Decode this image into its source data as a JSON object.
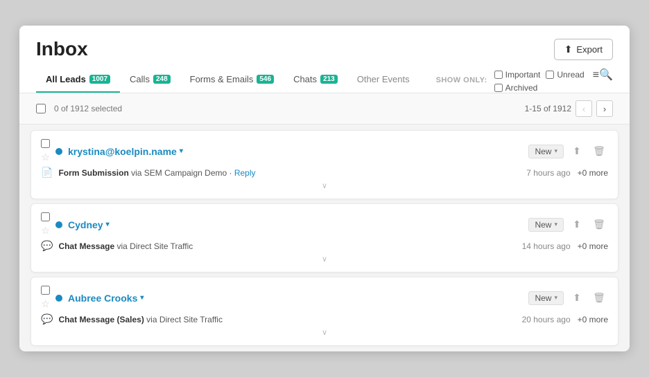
{
  "header": {
    "title": "Inbox",
    "export_label": "Export"
  },
  "tabs": [
    {
      "id": "all-leads",
      "label": "All Leads",
      "badge": "1007",
      "active": true
    },
    {
      "id": "calls",
      "label": "Calls",
      "badge": "248",
      "active": false
    },
    {
      "id": "forms-emails",
      "label": "Forms & Emails",
      "badge": "546",
      "active": false
    },
    {
      "id": "chats",
      "label": "Chats",
      "badge": "213",
      "active": false
    },
    {
      "id": "other-events",
      "label": "Other Events",
      "badge": null,
      "active": false
    }
  ],
  "show_only": {
    "label": "SHOW ONLY:",
    "important_label": "Important",
    "unread_label": "Unread",
    "archived_label": "Archived"
  },
  "toolbar": {
    "selected_count": "0 of 1912 selected",
    "pagination": "1-15 of 1912"
  },
  "leads": [
    {
      "id": 1,
      "name": "krystina@koelpin.name",
      "status": "New",
      "event_icon": "📄",
      "event_type": "Form Submission",
      "event_via": "via SEM Campaign Demo",
      "event_has_reply": true,
      "event_reply_label": "Reply",
      "time_ago": "7 hours ago",
      "more": "+0 more",
      "unread": true
    },
    {
      "id": 2,
      "name": "Cydney",
      "status": "New",
      "event_icon": "💬",
      "event_type": "Chat Message",
      "event_via": "via Direct Site Traffic",
      "event_has_reply": false,
      "event_reply_label": null,
      "time_ago": "14 hours ago",
      "more": "+0 more",
      "unread": true
    },
    {
      "id": 3,
      "name": "Aubree Crooks",
      "status": "New",
      "event_icon": "💬",
      "event_type": "Chat Message (Sales)",
      "event_via": "via Direct Site Traffic",
      "event_has_reply": false,
      "event_reply_label": null,
      "time_ago": "20 hours ago",
      "more": "+0 more",
      "unread": true
    }
  ],
  "icons": {
    "export": "⬆",
    "prev_page": "‹",
    "next_page": "›",
    "dropdown": "▾",
    "share": "⬆",
    "trash": "🗑",
    "filter": "≡🔍",
    "expand": "∨",
    "star": "☆"
  }
}
